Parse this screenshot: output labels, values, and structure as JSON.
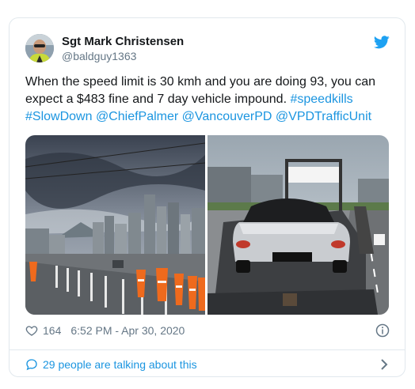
{
  "author": {
    "display_name": "Sgt Mark Christensen",
    "handle": "@baldguy1363",
    "avatar_icon": "avatar-photo"
  },
  "tweet": {
    "text_plain": "When the speed limit is 30 kmh and you are doing 93, you can expect a $483 fine and 7 day vehicle impound.",
    "tags": [
      "#speedkills",
      "#SlowDown",
      "@ChiefPalmer",
      "@VancouverPD",
      "@VPDTrafficUnit"
    ]
  },
  "media": [
    {
      "name": "bridge-traffic-cones-photo"
    },
    {
      "name": "porsche-on-tow-truck-photo"
    }
  ],
  "footer": {
    "like_count": "164",
    "timestamp": "6:52 PM - Apr 30, 2020",
    "conversation": "29 people are talking about this"
  },
  "colors": {
    "link": "#1b95e0",
    "twitter_blue": "#1da1f2",
    "secondary_text": "#657786",
    "border": "#e1e8ed"
  },
  "icons": {
    "brand": "twitter-bird-icon",
    "like": "heart-icon",
    "info": "info-icon",
    "conversation": "speech-bubble-icon",
    "more": "chevron-right-icon"
  }
}
